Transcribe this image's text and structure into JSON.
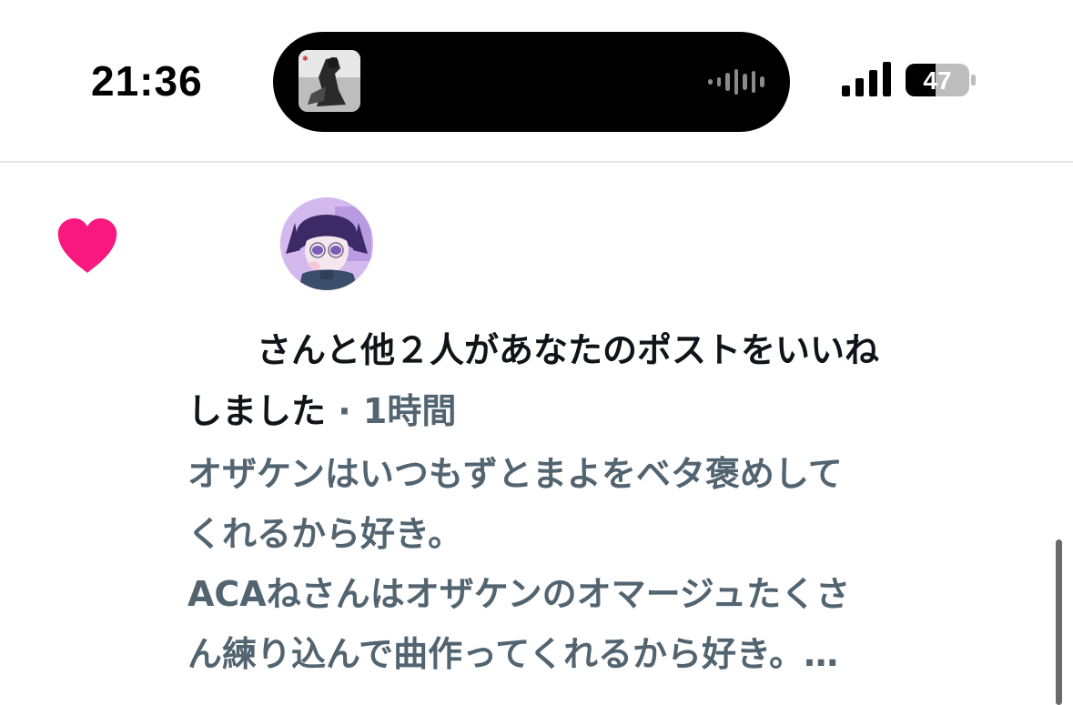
{
  "status_bar": {
    "time": "21:36",
    "battery": "47"
  },
  "notification": {
    "text_line1": "さんと他２人があなたのポストをいいね",
    "text_line2": "しました",
    "separator": " · ",
    "time_ago": "1時間",
    "post_lines": [
      "オザケンはいつもずとまよをベタ褒めして",
      "くれるから好き。",
      "ACAねさんはオザケンのオマージュたくさ",
      "ん練り込んで曲作ってくれるから好き。…"
    ]
  },
  "colors": {
    "heart": "#f91880",
    "post_text": "#536471",
    "primary_text": "#0f1419"
  }
}
